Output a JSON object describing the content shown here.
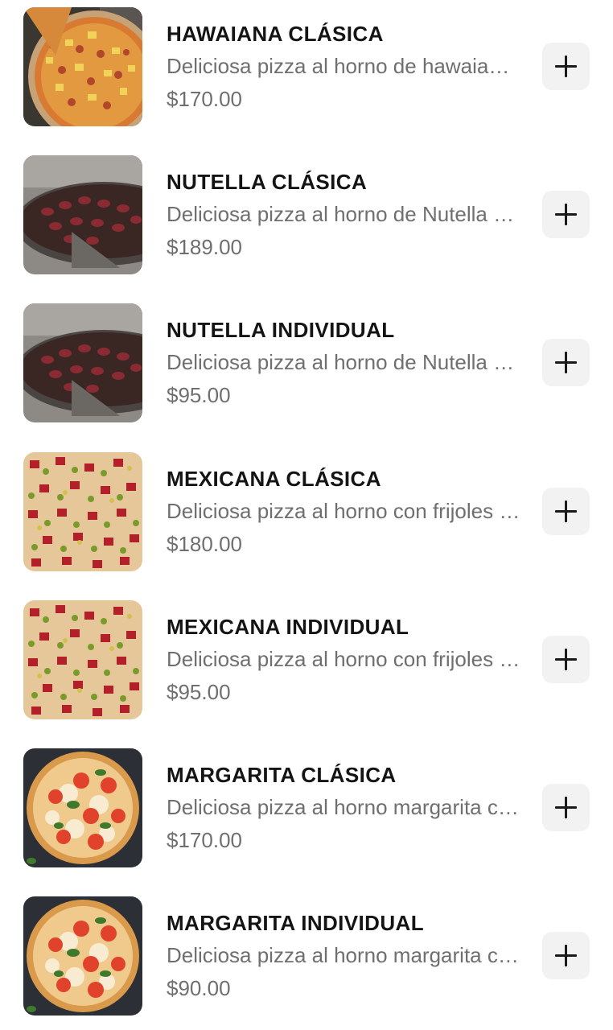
{
  "menu": {
    "items": [
      {
        "name": "HAWAIANA CLÁSICA",
        "description": "Deliciosa pizza al horno de hawaiana con piña y jamón",
        "price": "$170.00",
        "image": "hawaiian-pizza-photo"
      },
      {
        "name": "NUTELLA CLÁSICA",
        "description": "Deliciosa pizza al horno de Nutella con fresas",
        "price": "$189.00",
        "image": "nutella-pizza-photo"
      },
      {
        "name": "NUTELLA INDIVIDUAL",
        "description": "Deliciosa pizza al horno de Nutella con fresas",
        "price": "$95.00",
        "image": "nutella-pizza-photo"
      },
      {
        "name": "MEXICANA CLÁSICA",
        "description": "Deliciosa pizza al horno con frijoles y chorizo",
        "price": "$180.00",
        "image": "mexican-pizza-photo"
      },
      {
        "name": "MEXICANA INDIVIDUAL",
        "description": "Deliciosa pizza al horno con frijoles y chorizo",
        "price": "$95.00",
        "image": "mexican-pizza-photo"
      },
      {
        "name": "MARGARITA CLÁSICA",
        "description": "Deliciosa pizza al horno margarita con albahaca",
        "price": "$170.00",
        "image": "margherita-pizza-photo"
      },
      {
        "name": "MARGARITA INDIVIDUAL",
        "description": "Deliciosa pizza al horno margarita con albahaca",
        "price": "$90.00",
        "image": "margherita-pizza-photo"
      }
    ]
  },
  "icons": {
    "add": "plus-icon"
  },
  "colors": {
    "title": "#141414",
    "secondary_text": "#6f6f6f",
    "button_bg": "#f2f2f2"
  }
}
